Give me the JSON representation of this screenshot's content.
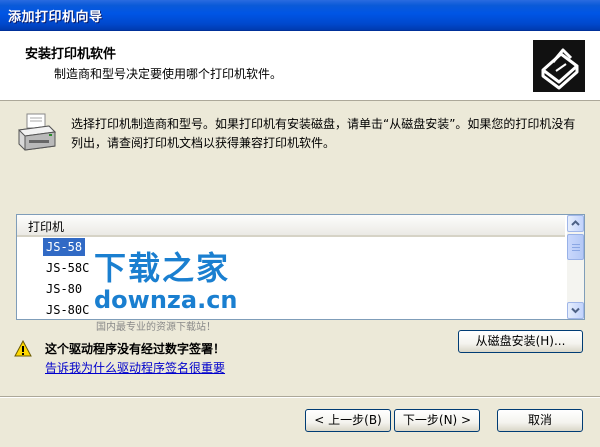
{
  "window": {
    "title": "添加打印机向导"
  },
  "header": {
    "title": "安装打印机软件",
    "subtitle": "制造商和型号决定要使用哪个打印机软件。",
    "icon": "printer-install-icon"
  },
  "intro": {
    "text": "选择打印机制造商和型号。如果打印机有安装磁盘，请单击“从磁盘安装”。如果您的打印机没有列出，请查阅打印机文档以获得兼容打印机软件。",
    "icon": "printer-icon"
  },
  "printer_list": {
    "header": "打印机",
    "items": [
      "JS-58",
      "JS-58C",
      "JS-80",
      "JS-80C"
    ],
    "selected": "JS-58"
  },
  "watermark": {
    "cn": "下载之家",
    "en": "downza.cn",
    "tagline": "国内最专业的资源下载站！"
  },
  "buttons": {
    "have_disk": "从磁盘安装(H)...",
    "back": "< 上一步(B)",
    "next": "下一步(N) >",
    "cancel": "取消"
  },
  "warning": {
    "text": "这个驱动程序没有经过数字签署！",
    "link": "告诉我为什么驱动程序签名很重要",
    "icon": "warning-icon"
  }
}
